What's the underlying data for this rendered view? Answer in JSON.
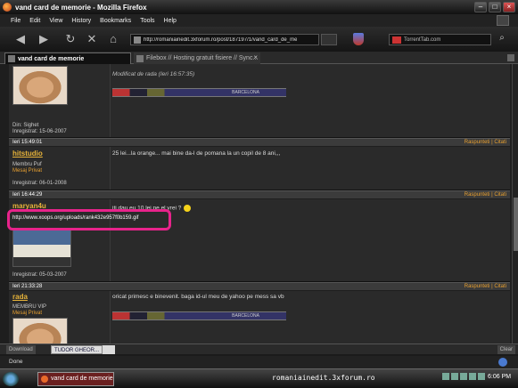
{
  "window": {
    "title": "vand card de memorie - Mozilla Firefox"
  },
  "menu": [
    "File",
    "Edit",
    "View",
    "History",
    "Bookmarks",
    "Tools",
    "Help"
  ],
  "nav": {
    "url": "http://romaniainedit.3xforum.ro/post/187197/1/vand_card_de_me",
    "search_engine": "TorrentTab.com"
  },
  "tabs": [
    {
      "label": "vand card de memorie",
      "active": true
    },
    {
      "label": "Filebox // Hosting gratuit fisiere // Sync...",
      "active": false
    }
  ],
  "posts": [
    {
      "from": "Din: Sighet",
      "registered": "Inregistrat: 15-06-2007",
      "edited": "Modificat de rada (Ieri 16:57:35)",
      "signature": "BARCELONA",
      "date": "Ieri 15:49:01"
    },
    {
      "username": "hitstudio",
      "rank": "Membru Puf",
      "pm": "Mesaj Privat",
      "registered": "Inregistrat: 06-01-2008",
      "text": "25 lei...la orange... mai bine da-l de pomana la un copil de 8 ani,,,",
      "date": "Ieri 16:44:29"
    },
    {
      "username": "maryan4u",
      "link": "http://www.xoops.org/uploads/rank432e957f0b159.gif",
      "registered": "Inregistrat: 05-03-2007",
      "text": "iti dau eu 10 lei pe el vrei ?",
      "date": "Ieri 21:33:28"
    },
    {
      "username": "rada",
      "rank": "MEMBRU VIP",
      "pm": "Mesaj Privat",
      "text": "oricat primesc e binevenit. baga id-ul meu de yahoo pe mess sa vb",
      "signature": "BARCELONA"
    }
  ],
  "actions": {
    "reply": "Raspunteti",
    "quote": "Citati",
    "sep": "|"
  },
  "downloads": {
    "item1": "Download",
    "item2": "TUDOR GHEOR...",
    "clear": "Clear"
  },
  "status": {
    "text": "Done"
  },
  "taskbar": {
    "task": "vand card de memorie",
    "center": "romaniainedit.3xforum.ro",
    "clock": "6:06 PM"
  },
  "colors": {
    "username": "#e8b43a",
    "highlight": "#e8238b",
    "link_action": "#e8a030"
  }
}
